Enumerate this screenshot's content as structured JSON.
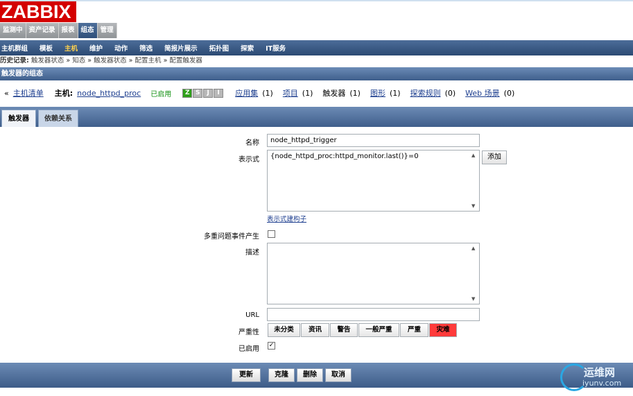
{
  "logo": "ZABBIX",
  "main_menu": [
    "监测中",
    "资产记录",
    "报表",
    "组态",
    "管理"
  ],
  "main_menu_active": "组态",
  "sub_menu": [
    "主机群组",
    "模板",
    "主机",
    "维护",
    "动作",
    "筛选",
    "简报片展示",
    "拓扑图",
    "探索",
    "IT服务"
  ],
  "sub_menu_active": "主机",
  "history": {
    "label": "历史记录:",
    "items": [
      "触发器状态",
      "知态",
      "触发器状态",
      "配置主机",
      "配置触发器"
    ],
    "sep": "»"
  },
  "page_title": "触发器的组态",
  "host_bar": {
    "back": "«",
    "host_list": "主机清单",
    "host_label": "主机:",
    "host_name": "node_httpd_proc",
    "status": "已启用",
    "availability": [
      "Z",
      "S",
      "J",
      "I"
    ],
    "apps": "应用集",
    "apps_count": "(1)",
    "items": "项目",
    "items_count": "(1)",
    "triggers": "触发器",
    "triggers_count": "(1)",
    "graphs": "图形",
    "graphs_count": "(1)",
    "discovery": "探索规则",
    "discovery_count": "(0)",
    "web": "Web 场景",
    "web_count": "(0)"
  },
  "tabs": [
    "触发器",
    "依赖关系"
  ],
  "form": {
    "name_label": "名称",
    "name_value": "node_httpd_trigger",
    "expr_label": "表示式",
    "expr_value": "{node_httpd_proc:httpd_monitor.last()}=0",
    "add_button": "添加",
    "expr_builder": "表示式建构子",
    "multiple_label": "多重问题事件产生",
    "desc_label": "描述",
    "url_label": "URL",
    "url_value": "",
    "severity_label": "严重性",
    "severities": [
      "未分类",
      "资讯",
      "警告",
      "一般严重",
      "严重",
      "灾难"
    ],
    "severity_selected": "灾难",
    "enabled_label": "已启用",
    "enabled_mark": "✓"
  },
  "footer_buttons": [
    "更新",
    "克隆",
    "删除",
    "取消"
  ],
  "watermark": {
    "cn": "运维网",
    "en": "iyunv.com"
  }
}
